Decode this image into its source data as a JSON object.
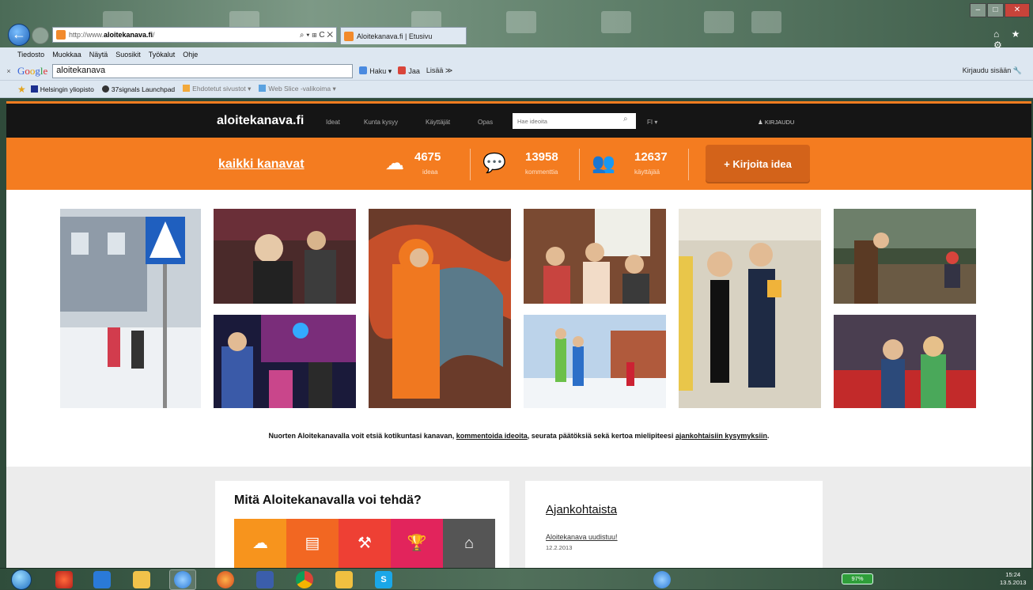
{
  "browser": {
    "url_prefix": "http://www.",
    "url_domain": "aloitekanava.fi",
    "url_suffix": "/",
    "address_actions": "⌕ ▾ ⊞ C ✕",
    "tab_title": "Aloitekanava.fi | Etusivu",
    "window_controls": [
      "–",
      "□",
      "✕"
    ],
    "toolbar_icons": "⌂ ★ ⚙",
    "menu": [
      "Tiedosto",
      "Muokkaa",
      "Näytä",
      "Suosikit",
      "Työkalut",
      "Ohje"
    ],
    "google_query": "aloitekanava",
    "google_logo": [
      "G",
      "o",
      "o",
      "g",
      "l",
      "e"
    ],
    "google_tools": [
      "Haku ▾",
      "Jaa",
      "Lisää ≫"
    ],
    "signin": "Kirjaudu sisään",
    "favorites": [
      "Helsingin yliopisto",
      "37signals Launchpad",
      "Ehdotetut sivustot ▾",
      "Web Slice -valikoima ▾"
    ]
  },
  "site": {
    "logo": "aloitekanava.fi",
    "nav": [
      "Ideat",
      "Kunta kysyy",
      "Käyttäjät",
      "Opas"
    ],
    "search_placeholder": "Hae ideoita",
    "language": "FI ▾",
    "login": "KIRJAUDU",
    "all_channels": "kaikki kanavat",
    "stats": [
      {
        "value": "4675",
        "label": "ideaa"
      },
      {
        "value": "13958",
        "label": "kommenttia"
      },
      {
        "value": "12637",
        "label": "käyttäjää"
      }
    ],
    "write_button": "+ Kirjoita idea",
    "intro": {
      "part1": "Nuorten Aloitekanavalla voit etsiä kotikuntasi kanavan, ",
      "link1": "kommentoida ideoita",
      "part2": ", seurata päätöksiä sekä kertoa mielipiteesi ",
      "link2": "ajankohtaisiin kysymyksiin",
      "part3": "."
    },
    "what_title": "Mitä Aloitekanavalla voi tehdä?",
    "tile_colors": [
      "#f7941d",
      "#f26722",
      "#ee4034",
      "#e2245c",
      "#555555"
    ],
    "news_title": "Ajankohtaista",
    "news_item": "Aloitekanava uudistuu!",
    "news_date": "12.2.2013"
  },
  "taskbar": {
    "battery": "97%",
    "time": "15:24",
    "date": "13.5.2013"
  }
}
